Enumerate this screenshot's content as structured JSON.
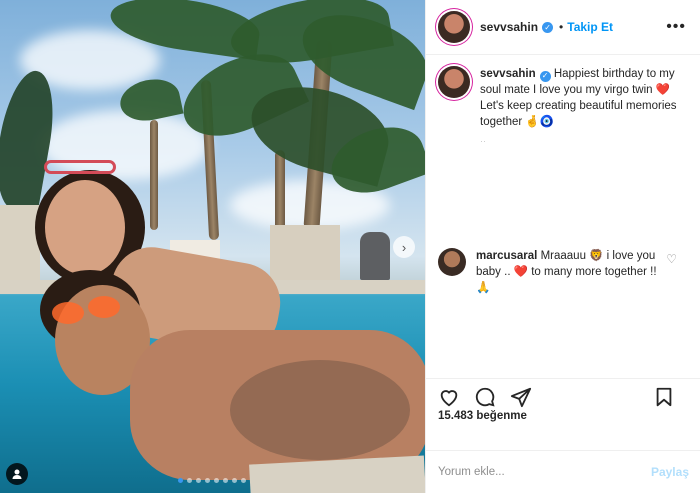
{
  "post": {
    "dots_count": 8,
    "active_dot": 0
  },
  "header": {
    "username": "sevvsahin",
    "follow_label": "Takip Et",
    "more_label": "•••"
  },
  "caption": {
    "username": "sevvsahin",
    "text": "Happiest birthday to my soul mate I love you my virgo twin ❤️ Let's keep creating beautiful memories together 🤞🧿"
  },
  "comment": {
    "username": "marcusaral",
    "text": "Mraaauu 🦁 i love you baby .. ❤️ to many more together !! 🙏"
  },
  "actions": {
    "likes_label": "15.483 beğenme"
  },
  "add_comment": {
    "placeholder": "Yorum ekle...",
    "post_label": "Paylaş"
  },
  "colors": {
    "accent": "#0095f6",
    "verified": "#3897f0",
    "heart": "#ed4956"
  },
  "icons": [
    "heart-icon",
    "comment-icon",
    "share-icon",
    "bookmark-icon",
    "verified-icon",
    "user-tag-icon",
    "chevron-right-icon"
  ]
}
